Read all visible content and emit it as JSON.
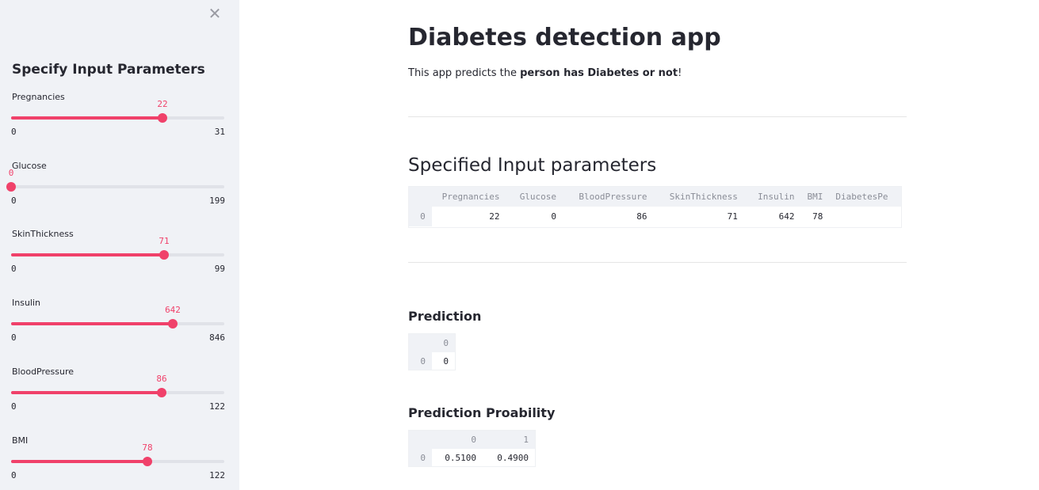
{
  "sidebar": {
    "title": "Specify Input Parameters",
    "sliders": [
      {
        "label": "Pregnancies",
        "value": "22",
        "min": "0",
        "max": "31",
        "fraction": 0.7097
      },
      {
        "label": "Glucose",
        "value": "0",
        "min": "0",
        "max": "199",
        "fraction": 0.0
      },
      {
        "label": "SkinThickness",
        "value": "71",
        "min": "0",
        "max": "99",
        "fraction": 0.7172
      },
      {
        "label": "Insulin",
        "value": "642",
        "min": "0",
        "max": "846",
        "fraction": 0.7589
      },
      {
        "label": "BloodPressure",
        "value": "86",
        "min": "0",
        "max": "122",
        "fraction": 0.7049
      },
      {
        "label": "BMI",
        "value": "78",
        "min": "0",
        "max": "122",
        "fraction": 0.6393
      }
    ],
    "close_icon": "close-icon",
    "accent": "#f0416a"
  },
  "main": {
    "title": "Diabetes detection app",
    "intro_prefix": "This app predicts the ",
    "intro_bold": "person has Diabetes or not",
    "intro_suffix": "!",
    "input_header": "Specified Input parameters",
    "input_table": {
      "columns": [
        "",
        "Pregnancies",
        "Glucose",
        "BloodPressure",
        "SkinThickness",
        "Insulin",
        "BMI",
        "DiabetesPe"
      ],
      "rows": [
        [
          "0",
          "22",
          "0",
          "86",
          "71",
          "642",
          "78",
          ""
        ]
      ]
    },
    "prediction_header": "Prediction",
    "prediction_table": {
      "columns": [
        "",
        "0"
      ],
      "rows": [
        [
          "0",
          "0"
        ]
      ]
    },
    "probability_header": "Prediction Proability",
    "probability_table": {
      "columns": [
        "",
        "0",
        "1"
      ],
      "rows": [
        [
          "0",
          "0.5100",
          "0.4900"
        ]
      ]
    }
  }
}
